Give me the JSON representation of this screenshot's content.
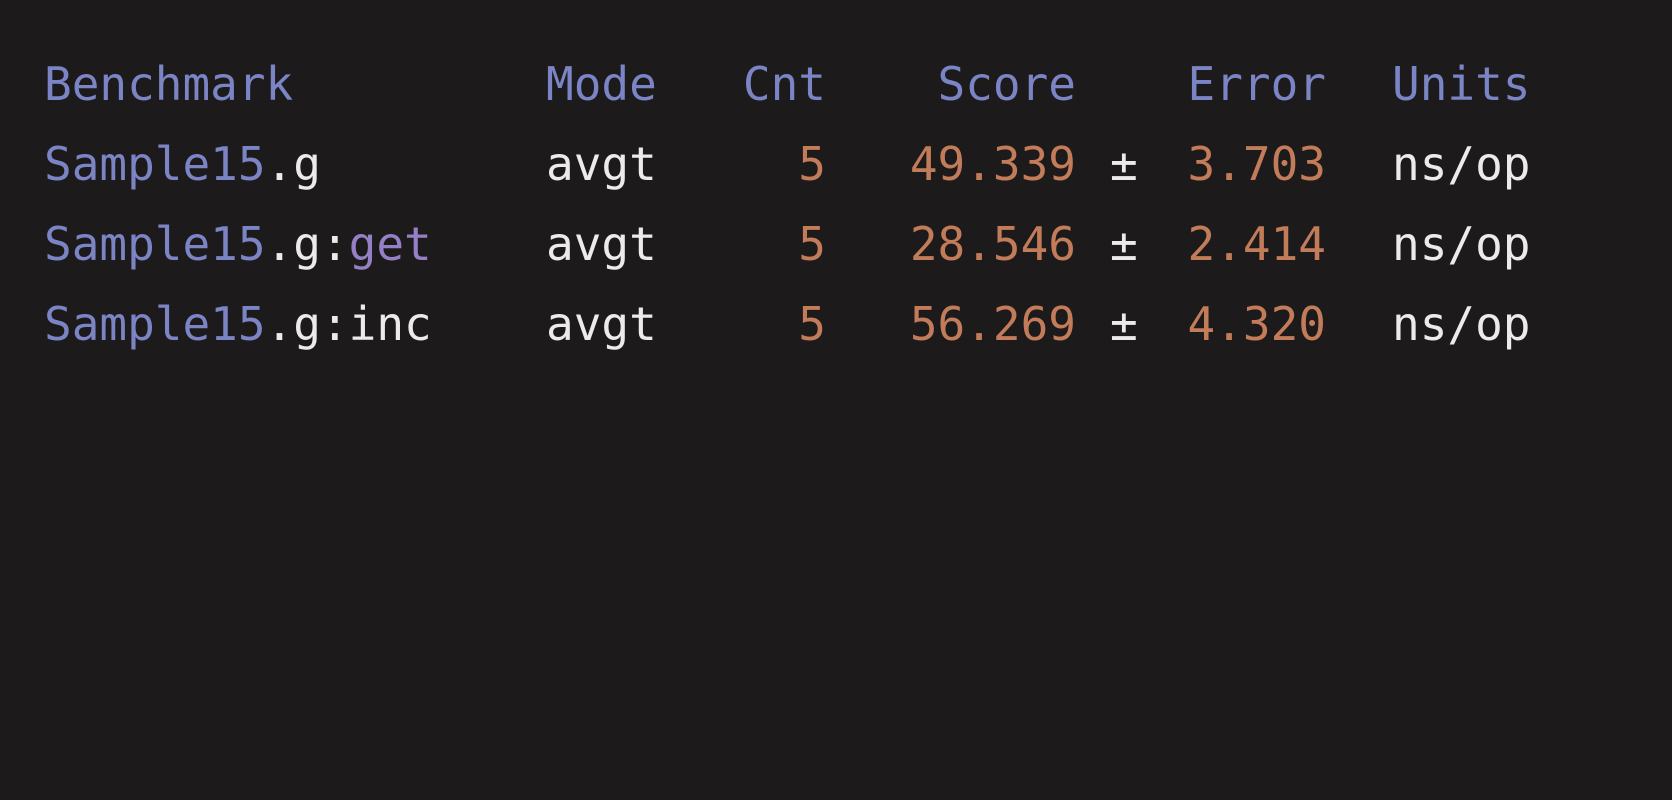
{
  "header": {
    "benchmark": "Benchmark",
    "mode": "Mode",
    "cnt": "Cnt",
    "score": "Score",
    "error": "Error",
    "units": "Units"
  },
  "rows": [
    {
      "class_name": "Sample15",
      "dot_field": ".g",
      "colon": "",
      "method": "",
      "mode": "avgt",
      "cnt": "5",
      "score": "49.339",
      "pm": "±",
      "error": "3.703",
      "units": "ns/op"
    },
    {
      "class_name": "Sample15",
      "dot_field": ".g",
      "colon": ":",
      "method": "get",
      "mode": "avgt",
      "cnt": "5",
      "score": "28.546",
      "pm": "±",
      "error": "2.414",
      "units": "ns/op"
    },
    {
      "class_name": "Sample15",
      "dot_field": ".g",
      "colon": ":",
      "method": "inc",
      "mode": "avgt",
      "cnt": "5",
      "score": "56.269",
      "pm": "±",
      "error": "4.320",
      "units": "ns/op"
    }
  ],
  "colors": {
    "background": "#1c1a1a",
    "header": "#7b84c4",
    "class_name": "#7b84c4",
    "method_highlight": "#9580c6",
    "plain_text": "#ecebea",
    "numbers": "#c27c5a"
  }
}
